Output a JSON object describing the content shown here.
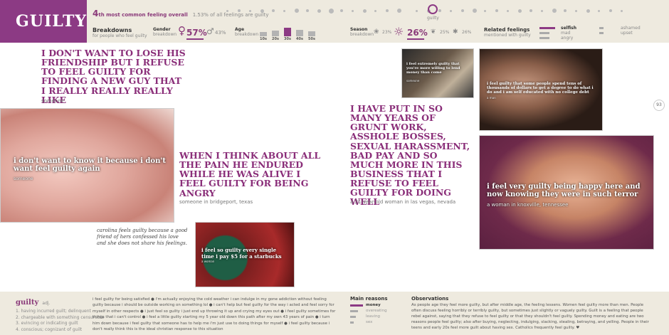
{
  "header": {
    "title": "GUILTY",
    "rank_number": "4",
    "rank_suffix": "th most common feeling overall",
    "rank_pct": "1.53% of all feelings are guilty",
    "dots_label": "guilty",
    "breakdowns_title": "Breakdowns",
    "breakdowns_sub": "for people who feel guilty",
    "gender_title": "Gender",
    "gender_sub": "breakdown",
    "gender_female_pct": "57%",
    "gender_male_pct": "43%",
    "age_title": "Age",
    "age_sub": "breakdown",
    "age_groups": [
      {
        "label": "10s",
        "value": 0.35
      },
      {
        "label": "20s",
        "value": 0.55
      },
      {
        "label": "30s",
        "value": 1.0
      },
      {
        "label": "40s",
        "value": 0.7
      },
      {
        "label": "50s",
        "value": 0.4
      }
    ],
    "season_title": "Season",
    "season_sub": "breakdown",
    "season_spring_pct": "23%",
    "season_summer_pct": "26%",
    "season_fall_pct": "25%",
    "season_winter_pct": "26%",
    "related_title": "Related feelings",
    "related_sub": "mentioned with guilty",
    "related": [
      "selfish",
      "mad",
      "angry",
      "ashamed",
      "upset"
    ],
    "page_number": "93"
  },
  "quotes": {
    "q1": "I DON'T WANT TO LOSE HIS FRIENDSHIP BUT I REFUSE TO FEEL GUILTY FOR FINDING A NEW GUY THAT I REALLY REALLY REALLY LIKE",
    "q1_who": "someone",
    "q2": "WHEN I THINK ABOUT ALL THE PAIN HE ENDURED WHILE HE WAS ALIVE I FEEL GUILTY FOR BEING ANGRY",
    "q2_who": "someone in bridgeport, texas",
    "q3": "I HAVE PUT IN SO MANY YEARS OF GRUNT WORK, ASSHOLE BOSSES, SEXUAL HARASSMENT, BAD PAY AND SO MUCH MORE IN THIS BUSINESS THAT I REFUSE TO FEEL GUILTY FOR DOING WELL",
    "q3_who": "a 21-year-old woman in las vegas, nevada"
  },
  "photos": {
    "p1_cap": "i don't want to know it because i don't want feel guilty again",
    "p1_who": "someone",
    "p2_cap": "i feel extremely guilty that you're more willing to lend money than come",
    "p2_who": "someone",
    "p3_cap": "i feel guilty that some people spend tens of thousands of dollars to get a degree to do what i do and i am self educated with no college debt",
    "p3_who": "a man",
    "p4_cap": "i feel so guilty every single time i pay $5 for a starbucks",
    "p4_who": "a woman",
    "p5_cap": "i feel very guilty being happy here and now knowing they were in such terror",
    "p5_who": "a woman in knoxville, tennessee"
  },
  "handwritten": "carolina feels guilty because a good friend of hers confessed his love and she does not share his feelings.",
  "footer": {
    "word": "guilty",
    "pos": "adj.",
    "defs": [
      "1. having incurred guilt; delinquent",
      "2. chargeable with something censurable",
      "3. evincing or indicating guilt",
      "4. conscious; cognizant of guilt"
    ],
    "snippets": "i feel guilty for being satisfied ● i'm actually enjoying the cold weather i can indulge in my gone addiction without feeling guilty because i should be outside working on something lol ● i can't help but feel guilty for the way i acted and feel sorry for myself in other respects ● i just feel so guilty i just end up throwing it up and crying my eyes out ● i feel guilty sometimes for things that i can't control ● i feel a little guilty starting my 5 year old down this path after my own 43 years of pain ● i turn him down because i feel guilty that someone has to help me i'm just use to doing things for myself ● i feel guilty because i don't really think this is the ideal christian response to this situation",
    "reasons_title": "Main reasons",
    "reasons": [
      {
        "label": "money",
        "value": 1.0
      },
      {
        "label": "overeating",
        "value": 0.6
      },
      {
        "label": "leaving",
        "value": 0.45
      },
      {
        "label": "sex",
        "value": 0.3
      }
    ],
    "obs_title": "Observations",
    "obs_text": "As people age they feel more guilty, but after middle age, the feeling lessens. Women feel guilty more than men. People often discuss feeling horribly or terribly guilty, but sometimes just slightly or vaguely guilty. Guilt is a feeling that people rebel against, saying that they refuse to feel guilty or that they shouldn't feel guilty. Spending money and eating are two reasons people feel guilty; also after buying, neglecting, indulging, slacking, stealing, betraying, and yelling. People in their teens and early 20s feel more guilt about having sex. Catholics frequently feel guilty. ♥"
  },
  "colors": {
    "accent": "#8c3a84",
    "band": "#eeeadf"
  }
}
